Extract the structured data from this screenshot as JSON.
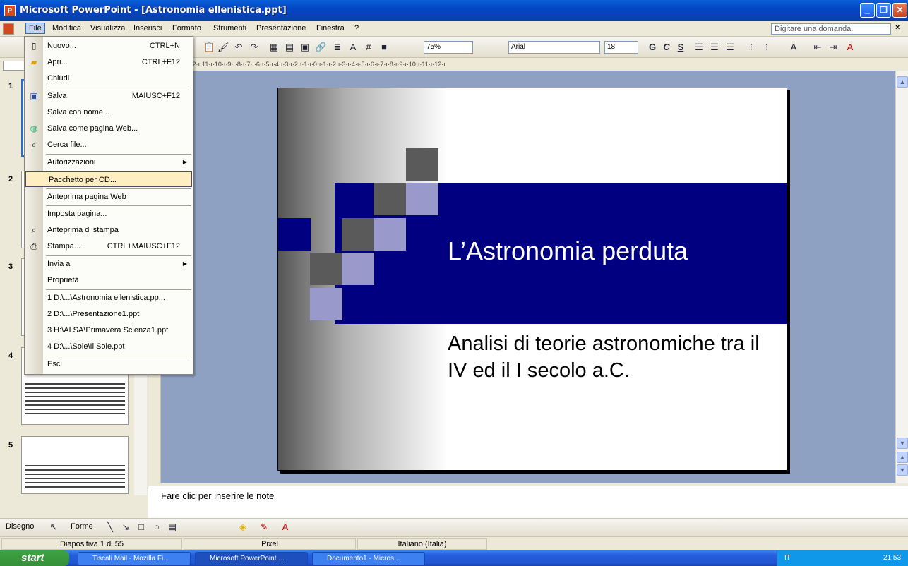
{
  "window": {
    "title": "Microsoft PowerPoint - [Astronomia ellenistica.ppt]",
    "min": "_",
    "max": "❐",
    "close": "✕"
  },
  "menubar": {
    "items": [
      "File",
      "Modifica",
      "Visualizza",
      "Inserisci",
      "Formato",
      "Strumenti",
      "Presentazione",
      "Finestra",
      "?"
    ],
    "help_placeholder": "Digitare una domanda."
  },
  "toolbar": {
    "zoom": "75%",
    "font": "Arial",
    "font_size": "18"
  },
  "ruler": "ı·12·ı·11·ı·10·ı·9·ı·8·ı·7·ı·6·ı·5·ı·4·ı·3·ı·2·ı·1·ı·0·ı·1·ı·2·ı·3·ı·4·ı·5·ı·6·ı·7·ı·8·ı·9·ı·10·ı·11·ı·12·ı",
  "file_menu": {
    "items": [
      {
        "label": "Nuovo...",
        "shortcut": "CTRL+N",
        "icon": "new-doc-icon"
      },
      {
        "label": "Apri...",
        "shortcut": "CTRL+F12",
        "icon": "open-folder-icon"
      },
      {
        "label": "Chiudi",
        "shortcut": ""
      },
      {
        "label": "Salva",
        "shortcut": "MAIUSC+F12",
        "icon": "save-icon"
      },
      {
        "label": "Salva con nome...",
        "shortcut": ""
      },
      {
        "label": "Salva come pagina Web...",
        "shortcut": "",
        "icon": "web-save-icon"
      },
      {
        "label": "Cerca file...",
        "shortcut": "",
        "icon": "search-file-icon"
      },
      {
        "label": "Autorizzazioni",
        "shortcut": "",
        "submenu": true
      },
      {
        "label": "Pacchetto per CD...",
        "shortcut": "",
        "highlighted": true
      },
      {
        "label": "Anteprima pagina Web",
        "shortcut": ""
      },
      {
        "label": "Imposta pagina...",
        "shortcut": ""
      },
      {
        "label": "Anteprima di stampa",
        "shortcut": "",
        "icon": "print-preview-icon"
      },
      {
        "label": "Stampa...",
        "shortcut": "CTRL+MAIUSC+F12",
        "icon": "print-icon"
      },
      {
        "label": "Invia a",
        "shortcut": "",
        "submenu": true
      },
      {
        "label": "Proprietà",
        "shortcut": ""
      },
      {
        "label": "1 D:\\...\\Astronomia ellenistica.pp...",
        "shortcut": ""
      },
      {
        "label": "2 D:\\...\\Presentazione1.ppt",
        "shortcut": ""
      },
      {
        "label": "3 H:\\ALSA\\Primavera Scienza1.ppt",
        "shortcut": ""
      },
      {
        "label": "4 D:\\...\\Sole\\Il Sole.ppt",
        "shortcut": ""
      },
      {
        "label": "Esci",
        "shortcut": ""
      }
    ]
  },
  "slide_pane": {
    "numbers": [
      "1",
      "2",
      "3",
      "4",
      "5"
    ]
  },
  "slide": {
    "title": "L’Astronomia perduta",
    "subtitle": "Analisi di teorie astronomiche tra il IV ed il I secolo a.C."
  },
  "notes": {
    "placeholder": "Fare clic per inserire le note"
  },
  "drawbar": {
    "draw_label": "Disegno",
    "shapes_label": "Forme"
  },
  "status": {
    "slide": "Diapositiva 1 di 55",
    "design": "Pixel",
    "language": "Italiano (Italia)"
  },
  "taskbar": {
    "start": "start",
    "tasks": [
      "Tiscali Mail - Mozilla Fi...",
      "Microsoft PowerPoint ...",
      "Documento1 - Micros..."
    ],
    "lang": "IT",
    "clock": "21.53"
  }
}
